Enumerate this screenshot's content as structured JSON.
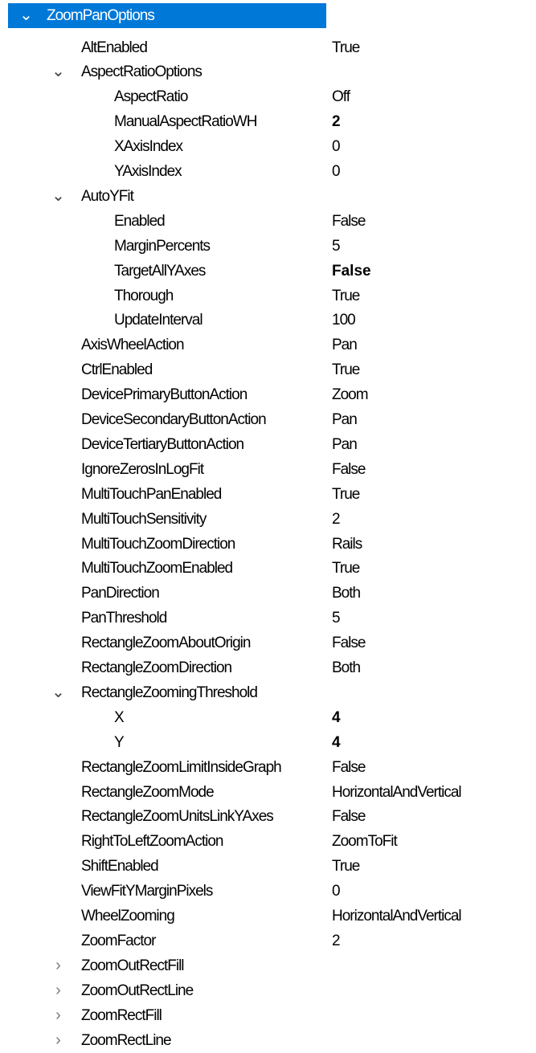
{
  "root": {
    "label": "ZoomPanOptions",
    "expanded": true,
    "selected": true,
    "selection_color": "#0078d7"
  },
  "rows": [
    {
      "label": "AltEnabled",
      "value": "True",
      "level": 1
    },
    {
      "label": "AspectRatioOptions",
      "value": "",
      "level": 1,
      "expander": "expanded"
    },
    {
      "label": "AspectRatio",
      "value": "Off",
      "level": 2
    },
    {
      "label": "ManualAspectRatioWH",
      "value": "2",
      "level": 2,
      "bold": true
    },
    {
      "label": "XAxisIndex",
      "value": "0",
      "level": 2
    },
    {
      "label": "YAxisIndex",
      "value": "0",
      "level": 2
    },
    {
      "label": "AutoYFit",
      "value": "",
      "level": 1,
      "expander": "expanded"
    },
    {
      "label": "Enabled",
      "value": "False",
      "level": 2
    },
    {
      "label": "MarginPercents",
      "value": "5",
      "level": 2
    },
    {
      "label": "TargetAllYAxes",
      "value": "False",
      "level": 2,
      "bold": true
    },
    {
      "label": "Thorough",
      "value": "True",
      "level": 2
    },
    {
      "label": "UpdateInterval",
      "value": "100",
      "level": 2
    },
    {
      "label": "AxisWheelAction",
      "value": "Pan",
      "level": 1
    },
    {
      "label": "CtrlEnabled",
      "value": "True",
      "level": 1
    },
    {
      "label": "DevicePrimaryButtonAction",
      "value": "Zoom",
      "level": 1
    },
    {
      "label": "DeviceSecondaryButtonAction",
      "value": "Pan",
      "level": 1
    },
    {
      "label": "DeviceTertiaryButtonAction",
      "value": "Pan",
      "level": 1
    },
    {
      "label": "IgnoreZerosInLogFit",
      "value": "False",
      "level": 1
    },
    {
      "label": "MultiTouchPanEnabled",
      "value": "True",
      "level": 1
    },
    {
      "label": "MultiTouchSensitivity",
      "value": "2",
      "level": 1
    },
    {
      "label": "MultiTouchZoomDirection",
      "value": "Rails",
      "level": 1
    },
    {
      "label": "MultiTouchZoomEnabled",
      "value": "True",
      "level": 1
    },
    {
      "label": "PanDirection",
      "value": "Both",
      "level": 1
    },
    {
      "label": "PanThreshold",
      "value": "5",
      "level": 1
    },
    {
      "label": "RectangleZoomAboutOrigin",
      "value": "False",
      "level": 1
    },
    {
      "label": "RectangleZoomDirection",
      "value": "Both",
      "level": 1
    },
    {
      "label": "RectangleZoomingThreshold",
      "value": "",
      "level": 1,
      "expander": "expanded"
    },
    {
      "label": "X",
      "value": "4",
      "level": 2,
      "bold": true
    },
    {
      "label": "Y",
      "value": "4",
      "level": 2,
      "bold": true
    },
    {
      "label": "RectangleZoomLimitInsideGraph",
      "value": "False",
      "level": 1
    },
    {
      "label": "RectangleZoomMode",
      "value": "HorizontalAndVertical",
      "level": 1
    },
    {
      "label": "RectangleZoomUnitsLinkYAxes",
      "value": "False",
      "level": 1
    },
    {
      "label": "RightToLeftZoomAction",
      "value": "ZoomToFit",
      "level": 1
    },
    {
      "label": "ShiftEnabled",
      "value": "True",
      "level": 1
    },
    {
      "label": "ViewFitYMarginPixels",
      "value": "0",
      "level": 1
    },
    {
      "label": "WheelZooming",
      "value": "HorizontalAndVertical",
      "level": 1
    },
    {
      "label": "ZoomFactor",
      "value": "2",
      "level": 1
    },
    {
      "label": "ZoomOutRectFill",
      "value": "",
      "level": 1,
      "expander": "collapsed"
    },
    {
      "label": "ZoomOutRectLine",
      "value": "",
      "level": 1,
      "expander": "collapsed"
    },
    {
      "label": "ZoomRectFill",
      "value": "",
      "level": 1,
      "expander": "collapsed"
    },
    {
      "label": "ZoomRectLine",
      "value": "",
      "level": 1,
      "expander": "collapsed"
    }
  ]
}
